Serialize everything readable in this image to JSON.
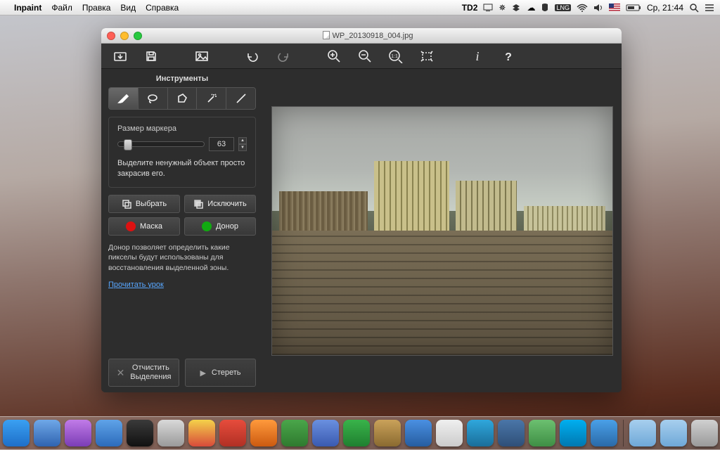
{
  "menubar": {
    "app_name": "Inpaint",
    "items": [
      "Файл",
      "Правка",
      "Вид",
      "Справка"
    ],
    "tray": {
      "td_label": "2",
      "clock": "Ср, 21:44"
    }
  },
  "window": {
    "title": "WP_20130918_004.jpg",
    "toolbar_icons": [
      "open",
      "save",
      "image",
      "undo",
      "redo",
      "zoom-in",
      "zoom-out",
      "zoom-1-1",
      "fit",
      "info",
      "help"
    ]
  },
  "sidebar": {
    "tools_title": "Инструменты",
    "tools": [
      "marker",
      "lasso",
      "polygon",
      "wand",
      "line"
    ],
    "active_tool_index": 0,
    "marker_label": "Размер маркера",
    "marker_size": "63",
    "hint1": "Выделите ненужный объект просто закрасив его.",
    "buttons": {
      "select": "Выбрать",
      "exclude": "Исключить",
      "mask": "Маска",
      "donor": "Донор"
    },
    "colors": {
      "mask": "#d11",
      "donor": "#1a1"
    },
    "hint2": "Донор позволяет определить какие пикселы будут использованы для восстановления выделенной зоны.",
    "link": "Прочитать урок",
    "clear_line1": "Отчистить",
    "clear_line2": "Выделения",
    "erase": "Стереть"
  },
  "dock": {
    "apps": [
      {
        "n": "finder",
        "c1": "#3aa0f2",
        "c2": "#1e6fc8"
      },
      {
        "n": "safari",
        "c1": "#6fa8e8",
        "c2": "#2f63b0"
      },
      {
        "n": "itunes",
        "c1": "#c17be8",
        "c2": "#7b3db5"
      },
      {
        "n": "appstore",
        "c1": "#5fa3e8",
        "c2": "#2c6bbb"
      },
      {
        "n": "steam",
        "c1": "#3a3a3a",
        "c2": "#111"
      },
      {
        "n": "mail",
        "c1": "#d9d9d9",
        "c2": "#9a9a9a"
      },
      {
        "n": "chrome",
        "c1": "#f4d24a",
        "c2": "#d84a3a"
      },
      {
        "n": "todoist",
        "c1": "#e74c3c",
        "c2": "#b13024"
      },
      {
        "n": "flame",
        "c1": "#ff9a3c",
        "c2": "#cc5a10"
      },
      {
        "n": "evernote",
        "c1": "#4aa64a",
        "c2": "#2f7a2f"
      },
      {
        "n": "devon",
        "c1": "#6a90e0",
        "c2": "#3a5ab0"
      },
      {
        "n": "numbers",
        "c1": "#39b34a",
        "c2": "#1f8030"
      },
      {
        "n": "basket",
        "c1": "#caa25a",
        "c2": "#8a6a30"
      },
      {
        "n": "preview",
        "c1": "#4a90e2",
        "c2": "#265da0"
      },
      {
        "n": "calendar",
        "c1": "#efefef",
        "c2": "#ccc"
      },
      {
        "n": "telegram",
        "c1": "#2fa7dc",
        "c2": "#1a6e9a"
      },
      {
        "n": "vk",
        "c1": "#4a76a8",
        "c2": "#2f4f78"
      },
      {
        "n": "writer",
        "c1": "#6cc070",
        "c2": "#3f8f45"
      },
      {
        "n": "skype",
        "c1": "#00aff0",
        "c2": "#0078b0"
      },
      {
        "n": "tweetbot",
        "c1": "#4aa0e8",
        "c2": "#2a6aa8"
      }
    ],
    "right": [
      {
        "n": "dl-folder",
        "c1": "#a7cfee",
        "c2": "#6fa8d8"
      },
      {
        "n": "docs-folder",
        "c1": "#a7cfee",
        "c2": "#6fa8d8"
      },
      {
        "n": "trash",
        "c1": "#d0d0d0",
        "c2": "#9a9a9a"
      }
    ]
  }
}
